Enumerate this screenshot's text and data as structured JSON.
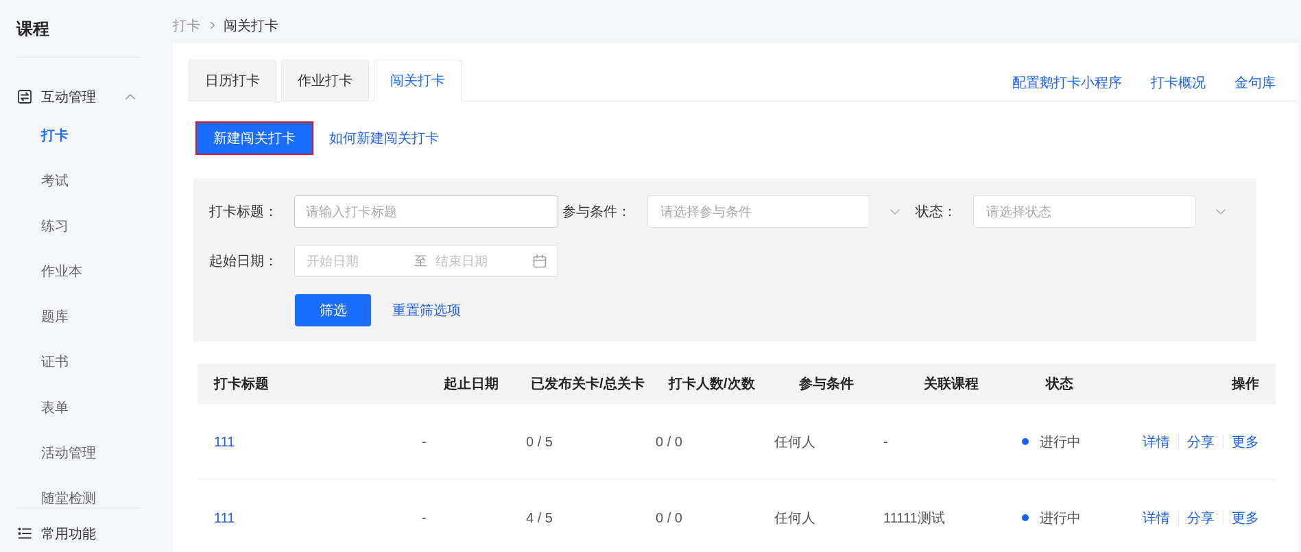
{
  "sidebar": {
    "title": "课程",
    "group": {
      "label": "互动管理",
      "expanded": true,
      "items": [
        {
          "label": "打卡",
          "selected": true
        },
        {
          "label": "考试",
          "selected": false
        },
        {
          "label": "练习",
          "selected": false
        },
        {
          "label": "作业本",
          "selected": false
        },
        {
          "label": "题库",
          "selected": false
        },
        {
          "label": "证书",
          "selected": false
        },
        {
          "label": "表单",
          "selected": false
        },
        {
          "label": "活动管理",
          "selected": false
        },
        {
          "label": "随堂检测",
          "selected": false
        }
      ]
    },
    "footer_item": {
      "label": "常用功能"
    }
  },
  "breadcrumb": [
    "打卡",
    "闯关打卡"
  ],
  "tabs": [
    {
      "label": "日历打卡",
      "selected": false
    },
    {
      "label": "作业打卡",
      "selected": false
    },
    {
      "label": "闯关打卡",
      "selected": true
    }
  ],
  "header_links": [
    "配置鹅打卡小程序",
    "打卡概况",
    "金句库"
  ],
  "create_button": {
    "label": "新建闯关打卡",
    "highlighted": true
  },
  "help_link": "如何新建闯关打卡",
  "filters": {
    "rows": [
      [
        {
          "kind": "text",
          "label": "打卡标题：",
          "placeholder": "请输入打卡标题"
        },
        {
          "kind": "select",
          "label": "参与条件：",
          "placeholder": "请选择参与条件"
        },
        {
          "kind": "select",
          "label": "状态：",
          "placeholder": "请选择状态"
        }
      ],
      [
        {
          "kind": "daterange",
          "label": "起始日期：",
          "start_placeholder": "开始日期",
          "separator": "至",
          "end_placeholder": "结束日期"
        }
      ]
    ],
    "submit": "筛选",
    "reset": "重置筛选项"
  },
  "table": {
    "columns": [
      "打卡标题",
      "起止日期",
      "已发布关卡/总关卡",
      "打卡人数/次数",
      "参与条件",
      "关联课程",
      "状态",
      "操作"
    ],
    "rows": [
      {
        "title": "111",
        "dates": "-",
        "levels": "0 / 5",
        "participants": "0 / 0",
        "condition": "任何人",
        "course": "-",
        "status": {
          "label": "进行中",
          "color": "#1462fa"
        },
        "actions": [
          "详情",
          "分享",
          "更多"
        ]
      },
      {
        "title": "111",
        "dates": "-",
        "levels": "4 / 5",
        "participants": "0 / 0",
        "condition": "任何人",
        "course": "11111测试",
        "status": {
          "label": "进行中",
          "color": "#1462fa"
        },
        "actions": [
          "详情",
          "分享",
          "更多"
        ]
      }
    ]
  }
}
